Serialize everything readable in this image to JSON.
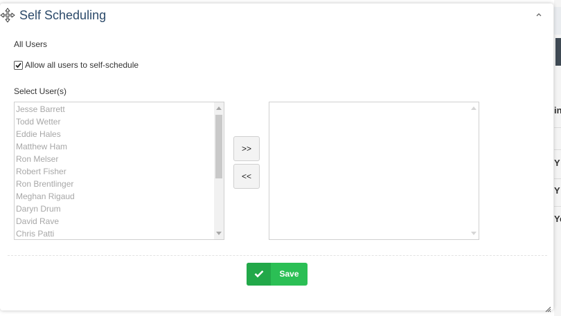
{
  "dialog": {
    "title": "Self Scheduling",
    "all_users_label": "All Users",
    "allow_all_label": "Allow all users to self-schedule",
    "allow_all_checked": true,
    "select_users_label": "Select User(s)",
    "available_users": [
      "Jesse Barrett",
      "Todd Wetter",
      "Eddie Hales",
      "Matthew Ham",
      "Ron Melser",
      "Robert Fisher",
      "Ron Brentlinger",
      "Meghan Rigaud",
      "Daryn Drum",
      "David Rave",
      "Chris Patti"
    ],
    "selected_users": [],
    "add_button_label": ">>",
    "remove_button_label": "<<",
    "save_button_label": "Save",
    "icons": {
      "move": "move-arrows-icon",
      "collapse": "chevron-up-icon",
      "save": "check-icon",
      "resize": "resize-grip-icon"
    },
    "colors": {
      "title": "#2c4a6a",
      "save_button": "#2bbf55",
      "save_icon_bg": "#22a849"
    }
  },
  "background_page": {
    "partial_text": [
      "in",
      "Y",
      "Y",
      "Ye"
    ]
  }
}
